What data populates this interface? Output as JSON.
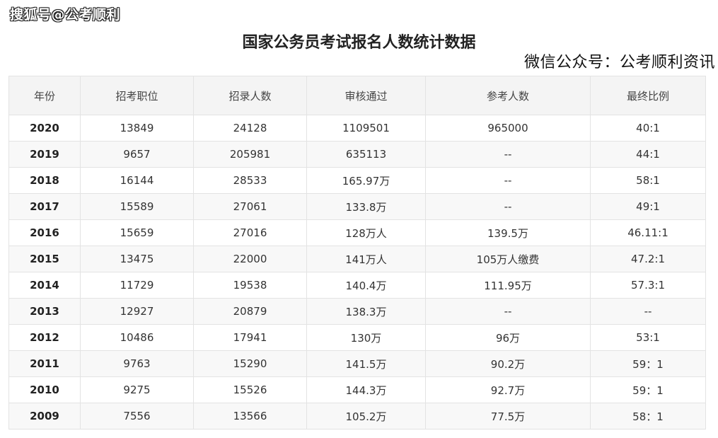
{
  "watermark": "搜狐号@公考顺利",
  "title": "国家公务员考试报名人数统计数据",
  "subtitle": "微信公众号：公考顺利资讯",
  "table": {
    "headers": [
      "年份",
      "招考职位",
      "招录人数",
      "审核通过",
      "参考人数",
      "最终比例"
    ],
    "rows": [
      [
        "2020",
        "13849",
        "24128",
        "1109501",
        "965000",
        "40:1"
      ],
      [
        "2019",
        "9657",
        "205981",
        "635113",
        "--",
        "44:1"
      ],
      [
        "2018",
        "16144",
        "28533",
        "165.97万",
        "--",
        "58:1"
      ],
      [
        "2017",
        "15589",
        "27061",
        "133.8万",
        "--",
        "49:1"
      ],
      [
        "2016",
        "15659",
        "27016",
        "128万人",
        "139.5万",
        "46.11:1"
      ],
      [
        "2015",
        "13475",
        "22000",
        "141万人",
        "105万人缴费",
        "47.2:1"
      ],
      [
        "2014",
        "11729",
        "19538",
        "140.4万",
        "111.95万",
        "57.3:1"
      ],
      [
        "2013",
        "12927",
        "20879",
        "138.3万",
        "--",
        "--"
      ],
      [
        "2012",
        "10486",
        "17941",
        "130万",
        "96万",
        "53:1"
      ],
      [
        "2011",
        "9763",
        "15290",
        "141.5万",
        "90.2万",
        "59：1"
      ],
      [
        "2010",
        "9275",
        "15526",
        "144.3万",
        "92.7万",
        "59：1"
      ],
      [
        "2009",
        "7556",
        "13566",
        "105.2万",
        "77.5万",
        "58：1"
      ]
    ]
  }
}
